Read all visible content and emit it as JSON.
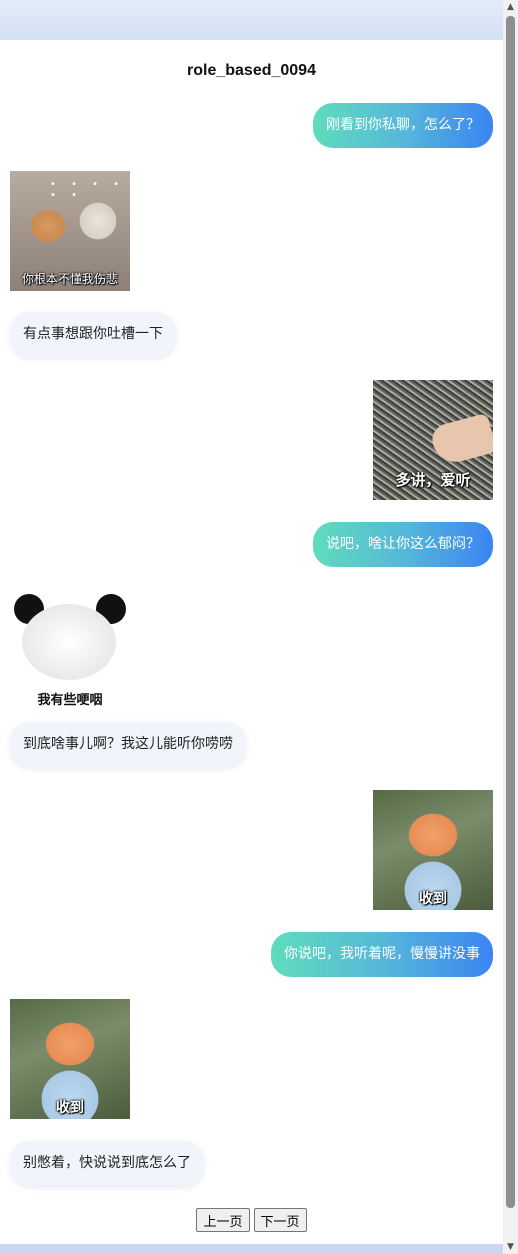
{
  "title": "role_based_0094",
  "messages": [
    {
      "side": "out",
      "type": "text",
      "text": "刚看到你私聊，怎么了？"
    },
    {
      "side": "in",
      "type": "sticker",
      "caption": "你根本不懂我伤悲"
    },
    {
      "side": "in",
      "type": "text",
      "text": "有点事想跟你吐槽一下"
    },
    {
      "side": "out",
      "type": "sticker",
      "caption": "多讲，爱听"
    },
    {
      "side": "out",
      "type": "text",
      "text": "说吧，啥让你这么郁闷？"
    },
    {
      "side": "in",
      "type": "sticker",
      "caption": "我有些哽咽"
    },
    {
      "side": "in",
      "type": "text",
      "text": "到底啥事儿啊？我这儿能听你唠唠"
    },
    {
      "side": "out",
      "type": "sticker",
      "caption": "收到"
    },
    {
      "side": "out",
      "type": "text",
      "text": "你说吧，我听着呢，慢慢讲没事"
    },
    {
      "side": "in",
      "type": "sticker",
      "caption": "收到"
    },
    {
      "side": "in",
      "type": "text",
      "text": "别憋着，快说说到底怎么了"
    }
  ],
  "pager": {
    "prev_label": "上一页",
    "next_label": "下一页"
  },
  "colors": {
    "out_bubble_start": "#5fdcbc",
    "out_bubble_end": "#3b84f2",
    "in_bubble": "#f1f4fa"
  }
}
